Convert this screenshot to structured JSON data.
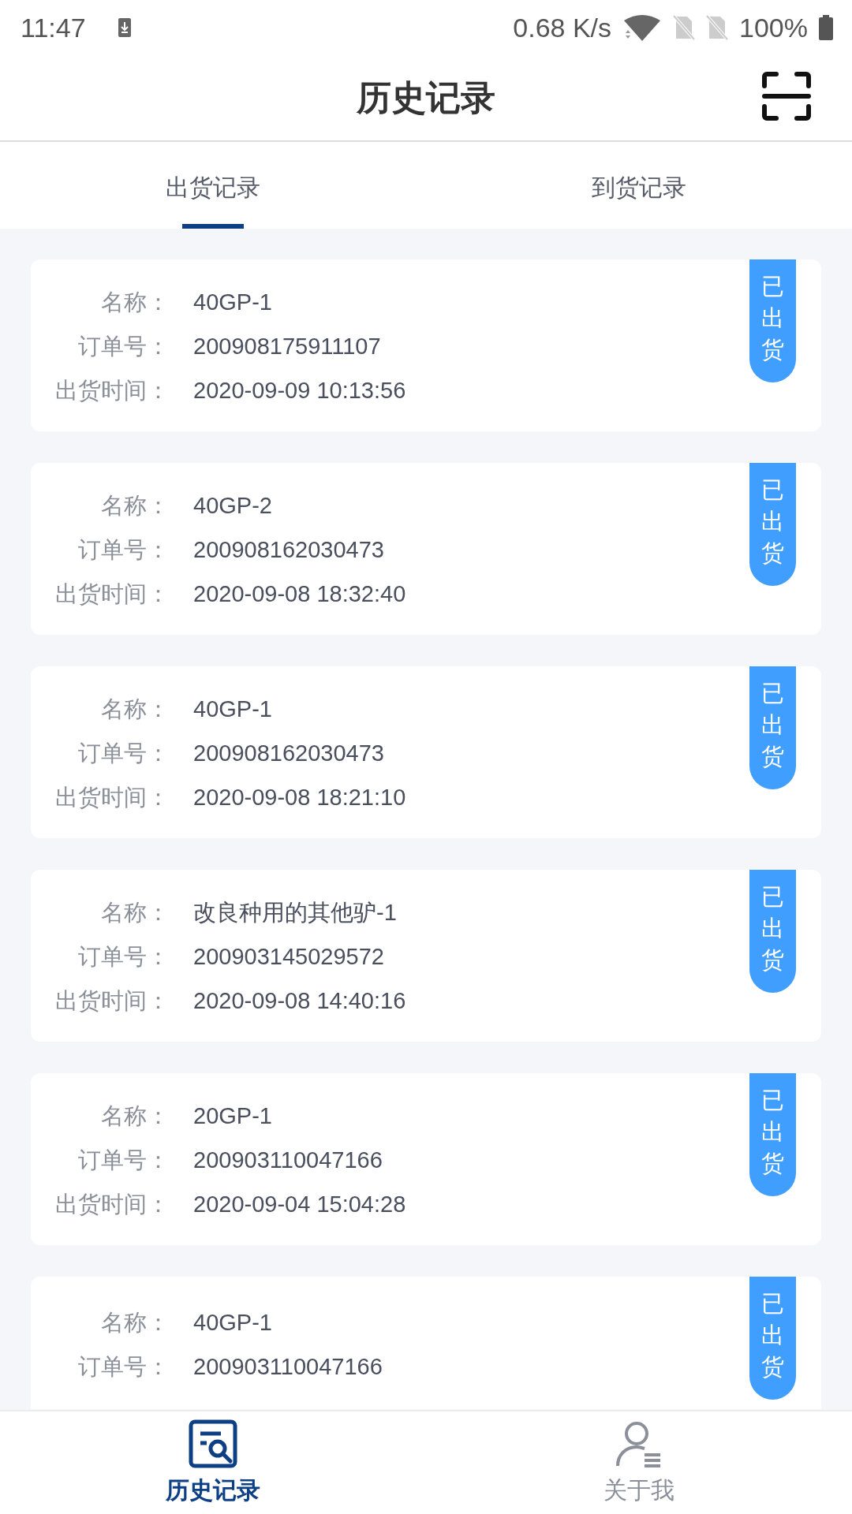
{
  "status_bar": {
    "time": "11:47",
    "speed": "0.68 K/s",
    "battery": "100%"
  },
  "header": {
    "title": "历史记录"
  },
  "tabs": [
    {
      "label": "出货记录",
      "selected": true
    },
    {
      "label": "到货记录",
      "selected": false
    }
  ],
  "records": [
    {
      "fields": [
        {
          "label": "名称：",
          "value": "40GP-1"
        },
        {
          "label": "订单号：",
          "value": "200908175911107"
        },
        {
          "label": "出货时间：",
          "value": "2020-09-09 10:13:56"
        }
      ],
      "badge": "已出货"
    },
    {
      "fields": [
        {
          "label": "名称：",
          "value": "40GP-2"
        },
        {
          "label": "订单号：",
          "value": "200908162030473"
        },
        {
          "label": "出货时间：",
          "value": "2020-09-08 18:32:40"
        }
      ],
      "badge": "已出货"
    },
    {
      "fields": [
        {
          "label": "名称：",
          "value": "40GP-1"
        },
        {
          "label": "订单号：",
          "value": "200908162030473"
        },
        {
          "label": "出货时间：",
          "value": "2020-09-08 18:21:10"
        }
      ],
      "badge": "已出货"
    },
    {
      "fields": [
        {
          "label": "名称：",
          "value": "改良种用的其他驴-1"
        },
        {
          "label": "订单号：",
          "value": "200903145029572"
        },
        {
          "label": "出货时间：",
          "value": "2020-09-08 14:40:16"
        }
      ],
      "badge": "已出货"
    },
    {
      "fields": [
        {
          "label": "名称：",
          "value": "20GP-1"
        },
        {
          "label": "订单号：",
          "value": "200903110047166"
        },
        {
          "label": "出货时间：",
          "value": "2020-09-04 15:04:28"
        }
      ],
      "badge": "已出货"
    },
    {
      "fields": [
        {
          "label": "名称：",
          "value": "40GP-1"
        },
        {
          "label": "订单号：",
          "value": "200903110047166"
        }
      ],
      "badge": "已出货"
    }
  ],
  "bottom_nav": [
    {
      "label": "历史记录",
      "kind": "history",
      "selected": true
    },
    {
      "label": "关于我",
      "kind": "profile",
      "selected": false
    }
  ]
}
